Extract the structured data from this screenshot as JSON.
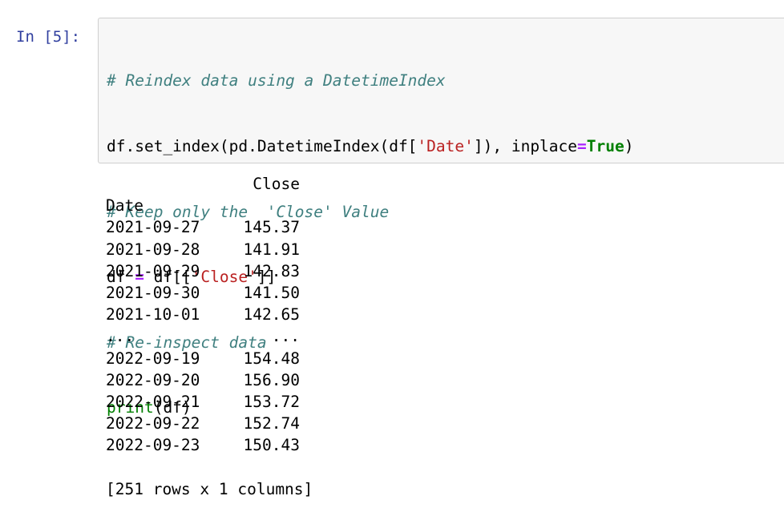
{
  "cell": {
    "prompt": "In [5]:",
    "code": {
      "comment1": "# Reindex data using a DatetimeIndex",
      "line2": {
        "pre": "df.set_index(pd.DatetimeIndex(df[",
        "str": "'Date'",
        "mid": "]), inplace",
        "op": "=",
        "kw": "True",
        "post": ")"
      },
      "comment2": "# Keep only the  'Close' Value",
      "line4": {
        "pre": "df ",
        "op": "=",
        "mid": " df[[",
        "str": "'Close'",
        "post": "]]"
      },
      "comment3": "# Re-inspect data",
      "line6": {
        "builtin": "print",
        "post": "(df)"
      }
    }
  },
  "output": {
    "column_header": "Close",
    "index_name": "Date",
    "rows": [
      {
        "date": "2021-09-27",
        "close": "145.37"
      },
      {
        "date": "2021-09-28",
        "close": "141.91"
      },
      {
        "date": "2021-09-29",
        "close": "142.83"
      },
      {
        "date": "2021-09-30",
        "close": "141.50"
      },
      {
        "date": "2021-10-01",
        "close": "142.65"
      },
      {
        "date": "...",
        "close": "..."
      },
      {
        "date": "2022-09-19",
        "close": "154.48"
      },
      {
        "date": "2022-09-20",
        "close": "156.90"
      },
      {
        "date": "2022-09-21",
        "close": "153.72"
      },
      {
        "date": "2022-09-22",
        "close": "152.74"
      },
      {
        "date": "2022-09-23",
        "close": "150.43"
      }
    ],
    "summary": "[251 rows x 1 columns]"
  },
  "colors": {
    "prompt": "#303f9f",
    "comment": "#408080",
    "string": "#ba2121",
    "operator": "#aa22ff",
    "keyword": "#008000",
    "cell_background": "#f7f7f7",
    "cell_border": "#cfcfcf"
  }
}
